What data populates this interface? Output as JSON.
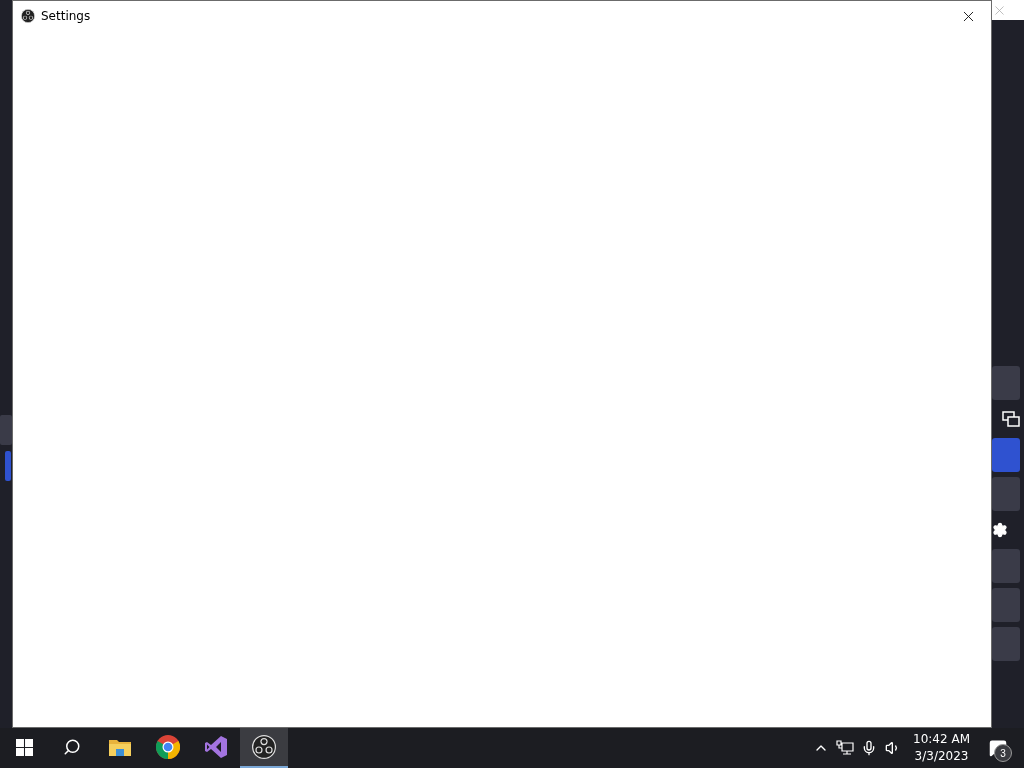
{
  "dialog": {
    "title": "Settings"
  },
  "background_window": {
    "left_dock": [
      {
        "selected": false
      },
      {
        "selected": true
      }
    ],
    "right_dock": [
      {
        "kind": "blank",
        "selected": false
      },
      {
        "kind": "windows",
        "selected": false
      },
      {
        "kind": "blank",
        "selected": true
      },
      {
        "kind": "blank",
        "selected": false
      },
      {
        "kind": "gear",
        "selected": false
      },
      {
        "kind": "blank",
        "selected": false
      },
      {
        "kind": "blank",
        "selected": false
      },
      {
        "kind": "blank",
        "selected": false
      }
    ]
  },
  "taskbar": {
    "apps": [
      {
        "kind": "start",
        "selected": false
      },
      {
        "kind": "search",
        "selected": false
      },
      {
        "kind": "folder",
        "selected": false
      },
      {
        "kind": "chrome",
        "selected": false
      },
      {
        "kind": "studio",
        "selected": false
      },
      {
        "kind": "obs",
        "selected": true
      }
    ],
    "time": "10:42 AM",
    "date": "3/3/2023",
    "notification_count": "3"
  }
}
